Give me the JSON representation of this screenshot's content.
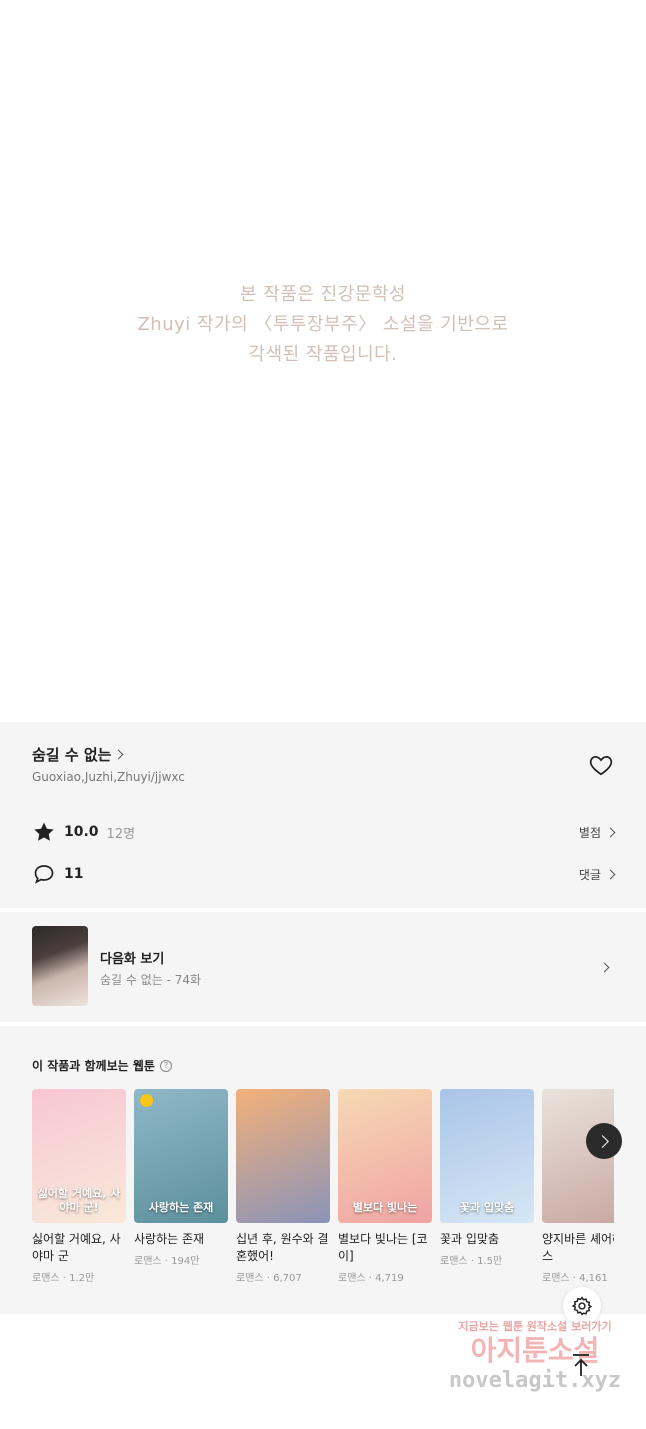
{
  "notice": {
    "line1": "본 작품은 진강문학성",
    "line2": "Zhuyi 작가의 〈투투장부주〉 소설을 기반으로",
    "line3": "각색된 작품입니다."
  },
  "work": {
    "title": "숨길 수 없는",
    "authors": "Guoxiao,Juzhi,Zhuyi/jjwxc",
    "rating": "10.0",
    "rating_count": "12명",
    "rating_link": "별점",
    "comment_count": "11",
    "comment_link": "댓글"
  },
  "next_episode": {
    "label": "다음화 보기",
    "sub": "숨길 수 없는 - 74화"
  },
  "recommendations": {
    "title": "이 작품과 함께보는 웹툰",
    "help_icon": "question-circle-icon",
    "items": [
      {
        "title": "싫어할 거예요, 사야마 군",
        "meta": "로맨스 · 1.2만",
        "colors": [
          "#f7c6d3",
          "#f9e9d9"
        ],
        "cover_text": "싫어할 거예요, 사야마 군!"
      },
      {
        "title": "사랑하는 존재",
        "meta": "로맨스 · 194만",
        "colors": [
          "#8fb8c8",
          "#5c8f9c"
        ],
        "cover_text": "사랑하는 존재"
      },
      {
        "title": "십년 후, 원수와 결혼했어!",
        "meta": "로맨스 · 6,707",
        "colors": [
          "#f3b07a",
          "#8a93b8"
        ],
        "cover_text": ""
      },
      {
        "title": "별보다 빛나는 [코이]",
        "meta": "로맨스 · 4,719",
        "colors": [
          "#f6d9b3",
          "#f0a3a3"
        ],
        "cover_text": "별보다 빛나는"
      },
      {
        "title": "꽃과 입맞춤",
        "meta": "로맨스 · 1.5만",
        "colors": [
          "#a9c4e8",
          "#d6e7f5"
        ],
        "cover_text": "꽃과 입맞춤"
      },
      {
        "title": "양지바른 셰어하우스",
        "meta": "로맨스 · 4,161",
        "colors": [
          "#e9e3dc",
          "#c9a6a0"
        ],
        "cover_text": ""
      }
    ]
  },
  "watermark": {
    "line1": "지금보는 웹툰 원작소설 보러가기",
    "line2": "아지툰소설",
    "line3": "novelagit.xyz"
  },
  "icons": {
    "heart": "heart-outline-icon",
    "star": "star-icon",
    "comment": "comment-bubble-icon",
    "settings": "gear-icon",
    "scroll_top": "arrow-up-to-line-icon",
    "scroll_right": "chevron-right-icon"
  }
}
